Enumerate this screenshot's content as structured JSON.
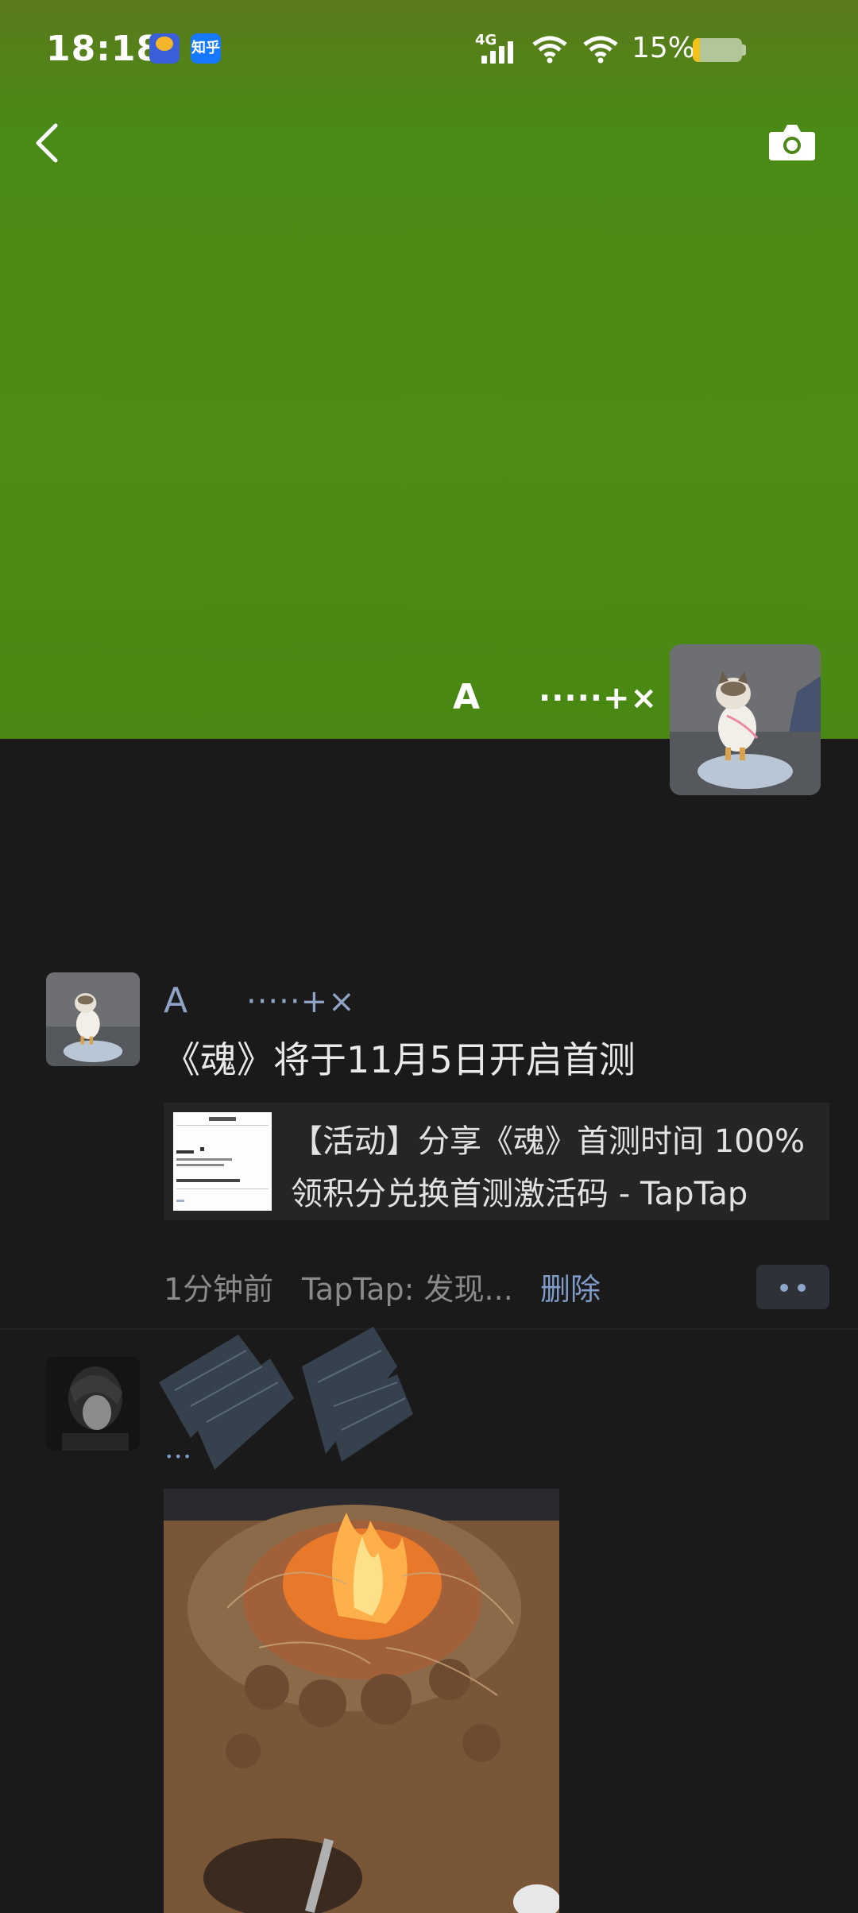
{
  "status_bar": {
    "time": "18:18",
    "network": "4G",
    "battery_percent": "15%",
    "battery_level": 0.15,
    "app_icon_2": "知乎"
  },
  "nav": {
    "back_icon": "chevron-left-icon",
    "camera_icon": "camera-icon"
  },
  "profile": {
    "name": "A",
    "signature": "·····+×"
  },
  "post1": {
    "name": "A",
    "signature": "·····+×",
    "text": "《魂》将于11月5日开启首测",
    "share_title": "【活动】分享《魂》首测时间 100%领积分兑换首测激活码 - TapTap",
    "time": "1分钟前",
    "source": "TapTap: 发现...",
    "delete_label": "删除"
  },
  "post2": {
    "image_count_indicator": "•••"
  },
  "colors": {
    "cover": "#4d8c16",
    "background": "#1a1a1a",
    "link": "#7f9bc8",
    "battery": "#f2c21b"
  }
}
